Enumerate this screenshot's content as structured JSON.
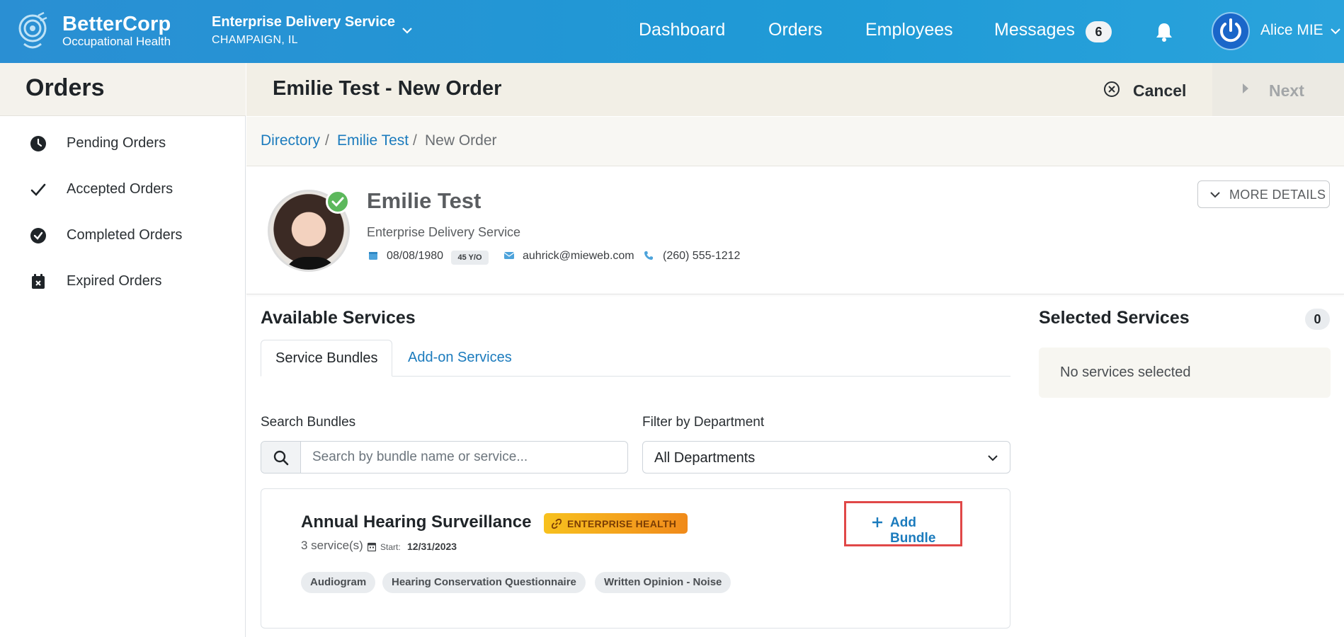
{
  "header": {
    "brand_name": "BetterCorp",
    "brand_sub": "Occupational Health",
    "company_name": "Enterprise Delivery Service",
    "company_location": "CHAMPAIGN, IL",
    "nav": [
      "Dashboard",
      "Orders",
      "Employees",
      "Messages"
    ],
    "messages_count": "6",
    "user_name": "Alice MIE",
    "accent_color": "#1f9ad6"
  },
  "sidebar": {
    "title": "Orders",
    "items": [
      {
        "label": "Pending Orders",
        "icon": "clock-icon"
      },
      {
        "label": "Accepted Orders",
        "icon": "check-icon"
      },
      {
        "label": "Completed Orders",
        "icon": "check-circle-icon"
      },
      {
        "label": "Expired Orders",
        "icon": "calendar-x-icon"
      }
    ]
  },
  "page": {
    "title": "Emilie Test - New Order",
    "cancel_label": "Cancel",
    "next_label": "Next"
  },
  "breadcrumb": {
    "items": [
      "Directory",
      "Emilie Test",
      "New Order"
    ],
    "separator": "/"
  },
  "profile": {
    "name": "Emilie Test",
    "company": "Enterprise Delivery Service",
    "dob": "08/08/1980",
    "age": "45 Y/O",
    "email": "auhrick@mieweb.com",
    "phone": "(260) 555-1212",
    "more_details_label": "MORE DETAILS"
  },
  "available_services": {
    "title": "Available Services",
    "tabs": [
      "Service Bundles",
      "Add-on Services"
    ],
    "active_tab": "Service Bundles",
    "search_label": "Search Bundles",
    "search_placeholder": "Search by bundle name or service...",
    "search_value": "",
    "filter_label": "Filter by Department",
    "filter_value": "All Departments",
    "bundles": [
      {
        "name": "Annual Hearing Surveillance",
        "badge": "ENTERPRISE HEALTH",
        "service_count": "3 service(s)",
        "start_label": "Start:",
        "start_date": "12/31/2023",
        "services": [
          "Audiogram",
          "Hearing Conservation Questionnaire",
          "Written Opinion - Noise"
        ],
        "add_label": "Add Bundle"
      }
    ]
  },
  "selected_services": {
    "title": "Selected Services",
    "count": "0",
    "empty_text": "No services selected"
  }
}
